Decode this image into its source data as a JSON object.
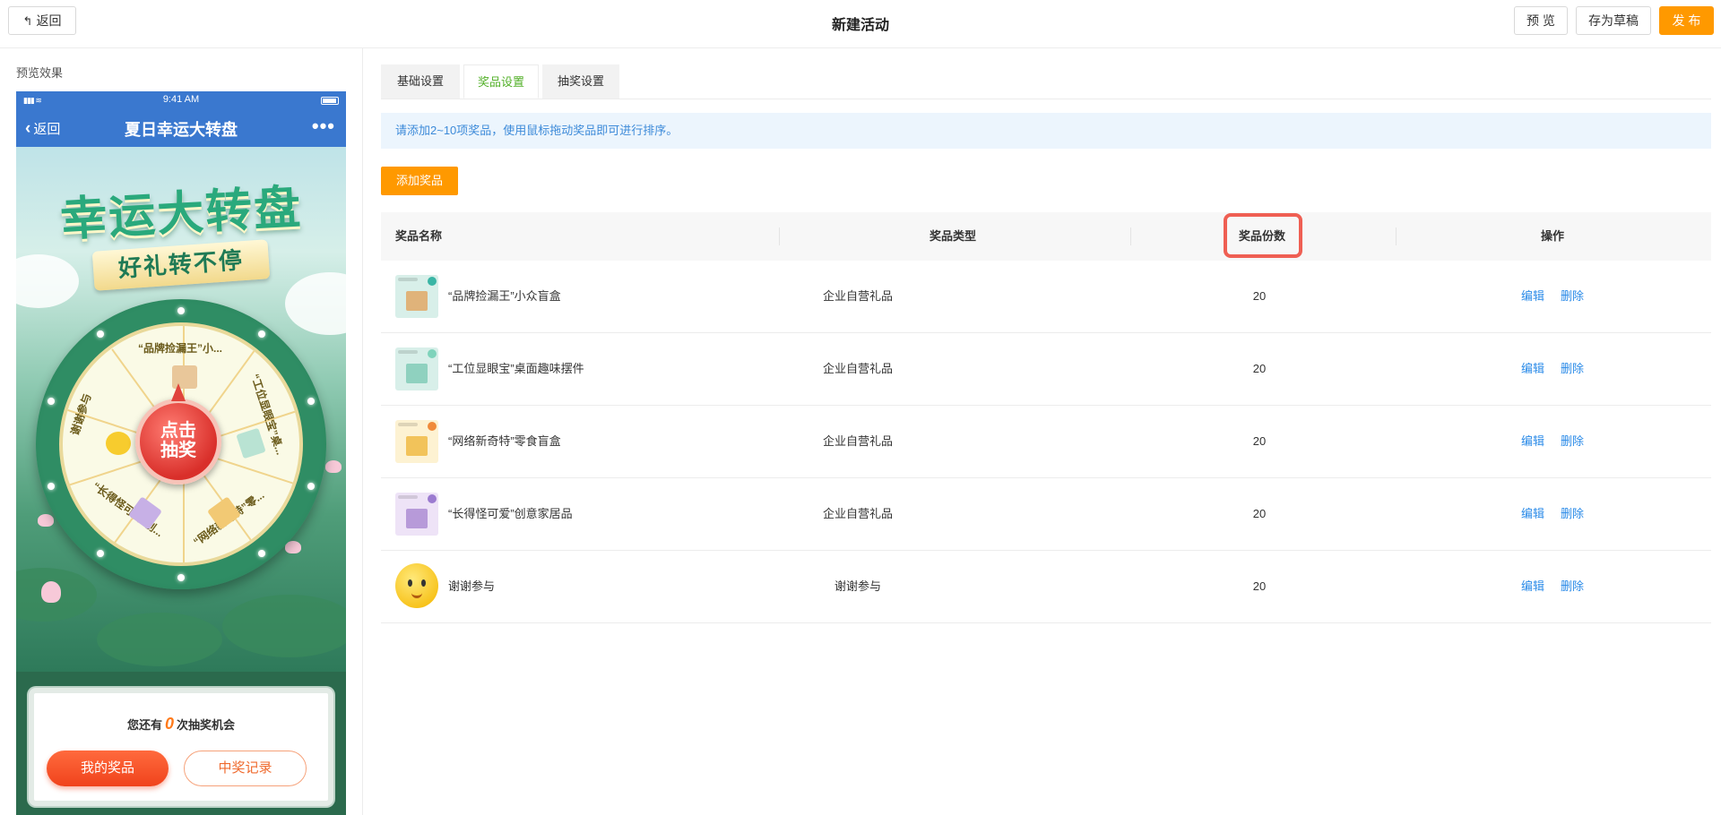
{
  "header": {
    "back_label": "返回",
    "title": "新建活动",
    "preview_label": "预 览",
    "draft_label": "存为草稿",
    "publish_label": "发 布",
    "accent": "#ff9900"
  },
  "preview": {
    "label": "预览效果",
    "status_time": "9:41 AM",
    "back_label": "返回",
    "title": "夏日幸运大转盘",
    "more_icon": "more-dots-icon",
    "banner_title": "幸运大转盘",
    "banner_subtitle": "好礼转不停",
    "wheel": {
      "button_line1": "点击",
      "button_line2": "抽奖",
      "segments": [
        "“品牌捡漏王”小...",
        "“工位显眼宝”桌...",
        "“网络新奇特”零...",
        "“长得怪可爱”创...",
        "谢谢参与"
      ]
    },
    "chance_prefix": "您还有",
    "chance_count": "0",
    "chance_suffix": "次抽奖机会",
    "my_prizes_label": "我的奖品",
    "records_label": "中奖记录"
  },
  "tabs": [
    {
      "label": "基础设置",
      "active": false
    },
    {
      "label": "奖品设置",
      "active": true
    },
    {
      "label": "抽奖设置",
      "active": false
    }
  ],
  "notice": "请添加2~10项奖品，使用鼠标拖动奖品即可进行排序。",
  "add_prize_label": "添加奖品",
  "table": {
    "columns": [
      "奖品名称",
      "奖品类型",
      "奖品份数",
      "操作"
    ],
    "edit_label": "编辑",
    "delete_label": "删除",
    "rows": [
      {
        "name": "“品牌捡漏王”小众盲盒",
        "type": "企业自营礼品",
        "count": "20",
        "thumb_color": "#d8efe9",
        "box_color": "#e0b37a",
        "dot_color": "#3ab5a5"
      },
      {
        "name": "“工位显眼宝”桌面趣味摆件",
        "type": "企业自营礼品",
        "count": "20",
        "thumb_color": "#d8efe9",
        "box_color": "#8fd1bf",
        "dot_color": "#7fd3bb"
      },
      {
        "name": "“网络新奇特”零食盲盒",
        "type": "企业自营礼品",
        "count": "20",
        "thumb_color": "#fdf2d2",
        "box_color": "#f2c35a",
        "dot_color": "#f08a3a"
      },
      {
        "name": "“长得怪可爱”创意家居品",
        "type": "企业自营礼品",
        "count": "20",
        "thumb_color": "#eee3f7",
        "box_color": "#b79ad9",
        "dot_color": "#9b7bd0"
      },
      {
        "name": "谢谢参与",
        "type": "谢谢参与",
        "count": "20",
        "thumb_color": "",
        "box_color": "",
        "dot_color": ""
      }
    ]
  }
}
